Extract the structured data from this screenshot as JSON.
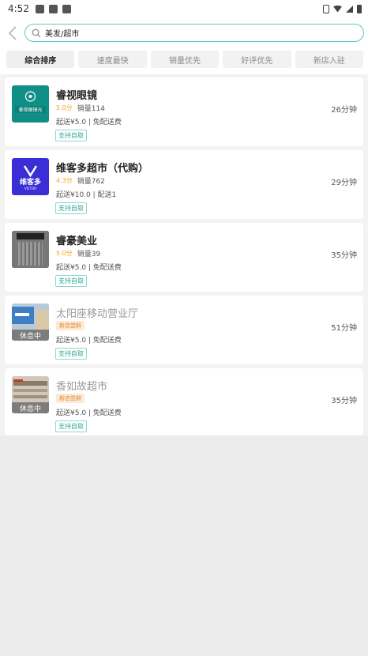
{
  "status_bar": {
    "time": "4:52"
  },
  "search": {
    "query": "美发/超市"
  },
  "sort_tabs": [
    "综合排序",
    "速度最快",
    "销量优先",
    "好评优先",
    "新店入驻"
  ],
  "stores": [
    {
      "name": "睿视眼镜",
      "logo_text": "睿视眼镜光",
      "score": "5.0分",
      "sales": "销量114",
      "delivery": "起送¥5.0 | 免配送费",
      "pickup": "支持自取",
      "time": "26分钟",
      "colors": {
        "logo_bg": "#0f8f86"
      }
    },
    {
      "name": "维客多超市（代购）",
      "logo_text": "维客多",
      "logo_sub": "VICTOR",
      "score": "4.3分",
      "sales": "销量762",
      "delivery": "起送¥10.0 | 配送1",
      "pickup": "支持自取",
      "time": "29分钟",
      "colors": {
        "logo_bg": "#3a2fd6"
      }
    },
    {
      "name": "睿豪美业",
      "score": "5.0分",
      "sales": "销量39",
      "delivery": "起送¥5.0 | 免配送费",
      "pickup": "支持自取",
      "time": "35分钟"
    },
    {
      "name": "太阳座移动营业厅",
      "badge": "新店尝鲜",
      "closed": "休息中",
      "delivery": "起送¥5.0 | 免配送费",
      "pickup": "支持自取",
      "time": "51分钟"
    },
    {
      "name": "香如故超市",
      "badge": "新店尝鲜",
      "closed": "休息中",
      "delivery": "起送¥5.0 | 免配送费",
      "pickup": "支持自取",
      "time": "35分钟"
    }
  ],
  "colors": {
    "accent": "#5ec7c2",
    "score": "#f5a623",
    "pickup": "#2ca896"
  }
}
